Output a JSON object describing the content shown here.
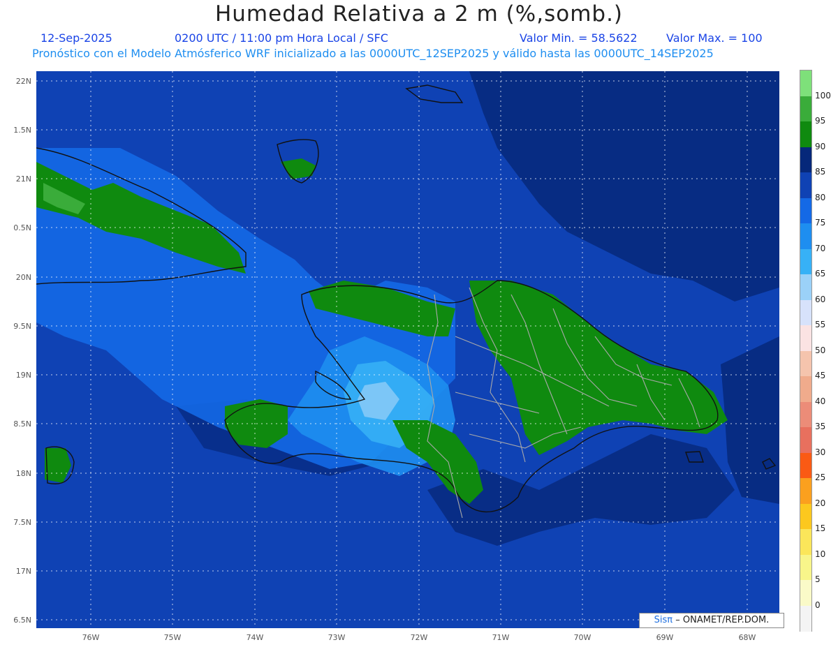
{
  "title": "Humedad Relativa a 2 m (%,somb.)",
  "header": {
    "date": "12-Sep-2025",
    "time": "0200 UTC / 11:00 pm Hora Local / SFC",
    "valor_min": "Valor Min. = 58.5622",
    "valor_max": "Valor Max. = 100",
    "forecast": "Pronóstico con el Modelo Atmósferico WRF inicializado a las 0000UTC_12SEP2025 y válido hasta las  0000UTC_14SEP2025"
  },
  "axes": {
    "lat_labels": [
      "22N",
      "1.5N",
      "21N",
      "0.5N",
      "20N",
      "9.5N",
      "19N",
      "8.5N",
      "18N",
      "7.5N",
      "17N",
      "6.5N"
    ],
    "lon_labels": [
      "76W",
      "75W",
      "74W",
      "73W",
      "72W",
      "71W",
      "70W",
      "69W",
      "68W"
    ]
  },
  "colorbar": {
    "labels": [
      "100",
      "95",
      "90",
      "85",
      "80",
      "75",
      "70",
      "65",
      "60",
      "55",
      "50",
      "45",
      "40",
      "35",
      "30",
      "25",
      "20",
      "15",
      "10",
      "5",
      "0"
    ],
    "colors": [
      "#7ee07a",
      "#3aac3a",
      "#0f8a0f",
      "#06287a",
      "#0f42b4",
      "#1469e6",
      "#1e8ef0",
      "#37b1f6",
      "#9bd1f8",
      "#d7e2fb",
      "#fbe3e3",
      "#f5c4ad",
      "#f0ab8c",
      "#ec8c78",
      "#e8705e",
      "#fa5a14",
      "#fba01e",
      "#fcc81e",
      "#fbe65a",
      "#f8f58a",
      "#fafac8",
      "#f4f4f4"
    ]
  },
  "credit": {
    "sis": "Sisπ",
    "text": "– ONAMET/REP.DOM."
  }
}
